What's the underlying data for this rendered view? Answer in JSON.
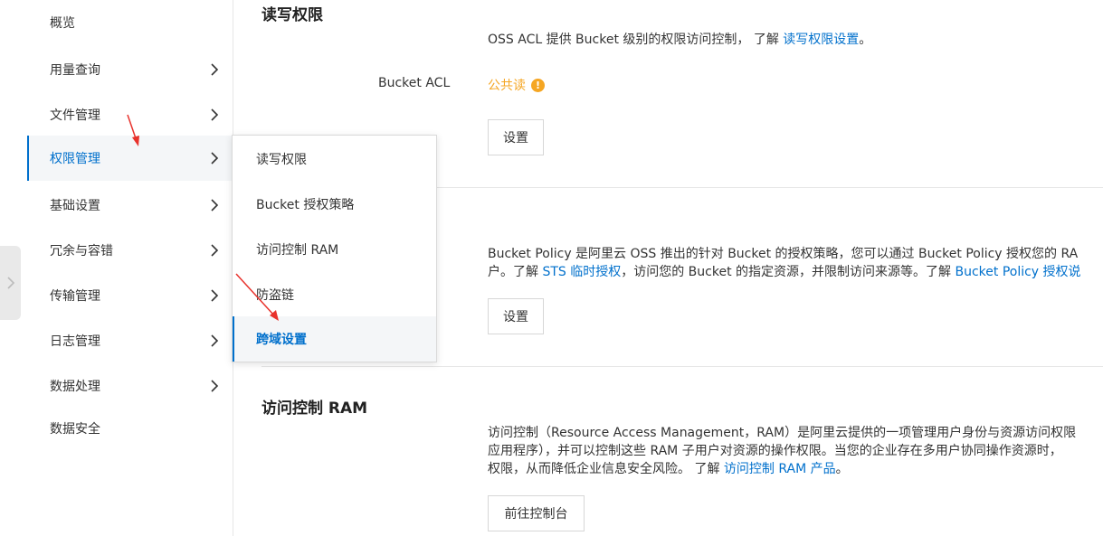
{
  "sidebar": {
    "items": [
      {
        "label": "概览",
        "has_chevron": false
      },
      {
        "label": "用量查询",
        "has_chevron": true
      },
      {
        "label": "文件管理",
        "has_chevron": true
      },
      {
        "label": "权限管理",
        "has_chevron": true,
        "active": true
      },
      {
        "label": "基础设置",
        "has_chevron": true
      },
      {
        "label": "冗余与容错",
        "has_chevron": true
      },
      {
        "label": "传输管理",
        "has_chevron": true
      },
      {
        "label": "日志管理",
        "has_chevron": true
      },
      {
        "label": "数据处理",
        "has_chevron": true
      },
      {
        "label": "数据安全",
        "has_chevron": false
      }
    ]
  },
  "popup": {
    "items": [
      {
        "label": "读写权限"
      },
      {
        "label": "Bucket 授权策略"
      },
      {
        "label": "访问控制 RAM"
      },
      {
        "label": "防盗链"
      },
      {
        "label": "跨域设置",
        "active": true
      }
    ]
  },
  "acl_section": {
    "title": "读写权限",
    "desc_prefix": "OSS ACL 提供 Bucket 级别的权限访问控制， 了解 ",
    "desc_link": "读写权限设置",
    "desc_suffix": "。",
    "row_label": "Bucket ACL",
    "value": "公共读",
    "button": "设置"
  },
  "policy_section": {
    "line1": "Bucket Policy 是阿里云 OSS 推出的针对 Bucket 的授权策略，您可以通过 Bucket Policy 授权您的 RA",
    "line2_prefix": "户。了解 ",
    "line2_link1": "STS 临时授权",
    "line2_mid": "，访问您的 Bucket 的指定资源，并限制访问来源等。了解 ",
    "line2_link2": "Bucket Policy 授权说",
    "button": "设置"
  },
  "ram_section": {
    "title": "访问控制 RAM",
    "line1": "访问控制（Resource Access Management，RAM）是阿里云提供的一项管理用户身份与资源访问权限",
    "line2": "应用程序），并可以控制这些 RAM 子用户对资源的操作权限。当您的企业存在多用户协同操作资源时，",
    "line3_prefix": "权限，从而降低企业信息安全风险。 了解 ",
    "line3_link": "访问控制 RAM 产品",
    "line3_suffix": "。",
    "button": "前往控制台"
  },
  "colors": {
    "accent": "#0070cc",
    "warning": "#f5a623",
    "annotation": "#e8322c"
  }
}
